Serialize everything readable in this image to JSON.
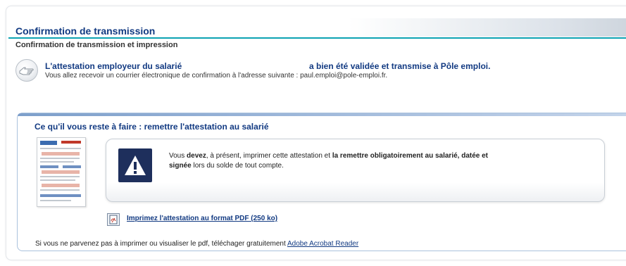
{
  "header": {
    "title": "Confirmation de transmission",
    "subtitle": "Confirmation de transmission et impression"
  },
  "confirmation": {
    "message_left": "L'attestation employeur du salarié",
    "message_right": "a bien été validée et transmise à Pôle emploi.",
    "email_notice": "Vous allez recevoir un courrier électronique de confirmation à l'adresse suivante : paul.emploi@pole-emploi.fr."
  },
  "todo": {
    "title": "Ce qu'il vous reste à faire : remettre l'attestation au salarié",
    "warning": {
      "t1": "Vous ",
      "t2": "devez",
      "t3": ", à présent, imprimer cette attestation et ",
      "t4": "la remettre obligatoirement au salarié, datée et",
      "t5": "signée",
      "t6": " lors du solde de tout compte."
    },
    "print_link": "Imprimez l'attestation au format PDF (250 ko)",
    "help_text": "Si vous ne parvenez pas à imprimer ou visualiser le pdf, téléchager gratuitement ",
    "help_link": "Adobe Acrobat Reader"
  },
  "icons": {
    "confirm": "hand-pointer-icon",
    "warning": "warning-triangle-icon",
    "pdf": "pdf-icon",
    "document": "document-thumbnail"
  },
  "colors": {
    "title_blue": "#123a82",
    "accent_teal": "#0da3b3",
    "warning_navy": "#1e2f5c"
  }
}
